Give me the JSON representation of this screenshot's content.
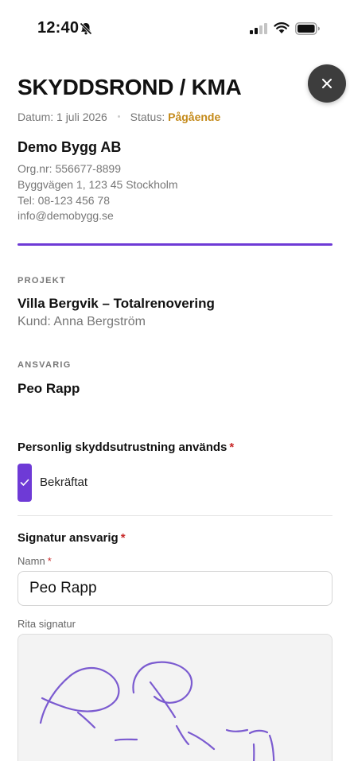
{
  "status_bar": {
    "time": "12:40"
  },
  "header": {
    "title": "SKYDDSROND / KMA"
  },
  "meta": {
    "date_label": "Datum:",
    "date_value": "1 juli 2026",
    "status_label": "Status:",
    "status_value": "Pågående"
  },
  "company": {
    "name": "Demo Bygg AB",
    "org": "Org.nr: 556677-8899",
    "address": "Byggvägen 1, 123 45 Stockholm",
    "phone": "Tel: 08-123 456 78",
    "email": "info@demobygg.se"
  },
  "project": {
    "section_label": "PROJEKT",
    "name": "Villa Bergvik – Totalrenovering",
    "client": "Kund: Anna Bergström"
  },
  "responsible": {
    "section_label": "ANSVARIG",
    "name": "Peo Rapp"
  },
  "ppe": {
    "label": "Personlig skyddsutrustning används",
    "required": "*",
    "checkbox_label": "Bekräftat",
    "checked": true
  },
  "signature": {
    "label": "Signatur ansvarig",
    "required": "*",
    "name_label": "Namn",
    "name_required": "*",
    "name_value": "Peo Rapp",
    "draw_label": "Rita signatur",
    "stroke_color": "#7b5bd0"
  },
  "colors": {
    "accent": "#6e3ad6",
    "status_pending": "#c48a1a",
    "required": "#c82828"
  }
}
